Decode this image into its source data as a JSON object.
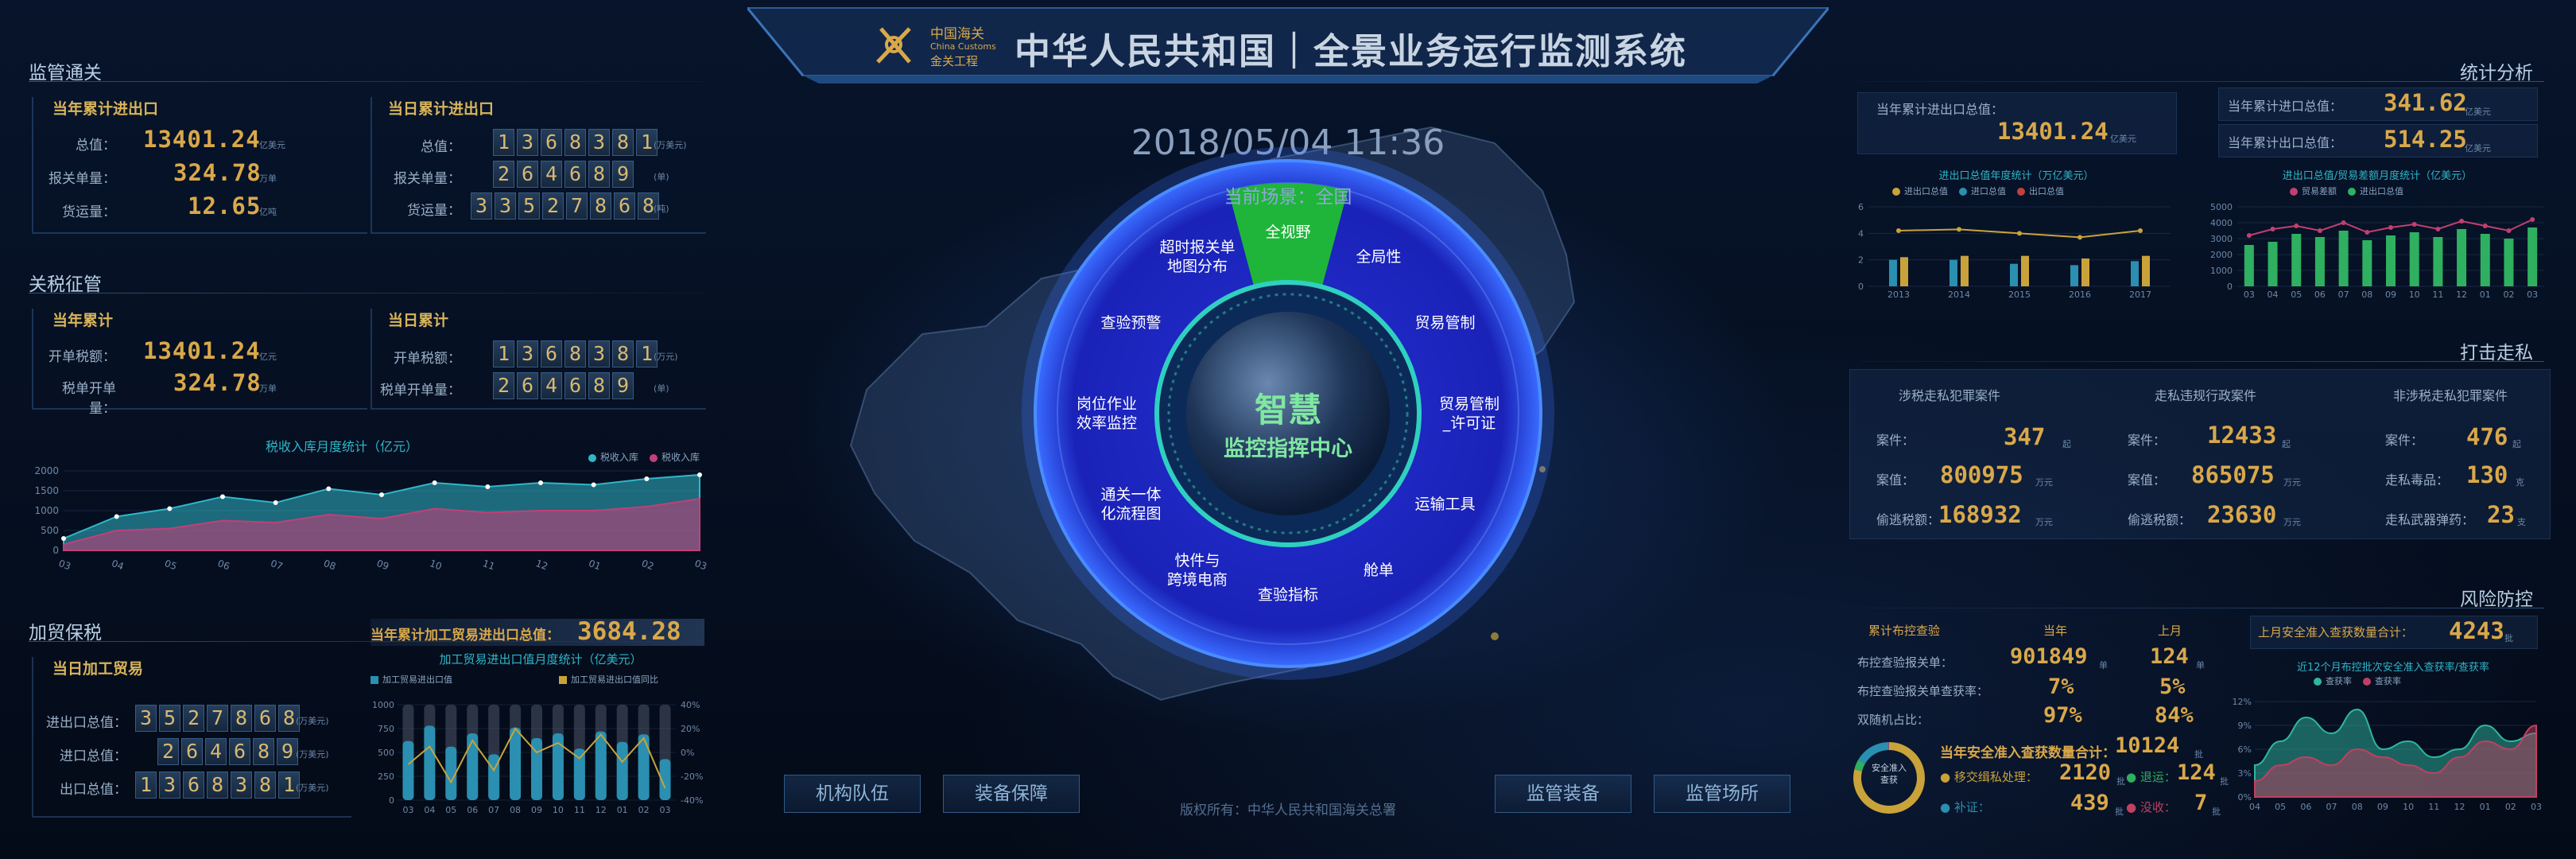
{
  "header": {
    "logo_cn": "中国海关",
    "logo_en": "China Customs",
    "logo_sub": "金关工程",
    "title": "中华人民共和国｜全景业务运行监测系统"
  },
  "datetime": "2018/05/04  11:36",
  "sections": {
    "supervision": "监管通关",
    "tariff": "关税征管",
    "processing": "加贸保税",
    "stats": "统计分析",
    "smuggling": "打击走私",
    "risk": "风险防控"
  },
  "supervision": {
    "left": {
      "title": "当年累计进出口",
      "rows": [
        {
          "label": "总值：",
          "value": "13401.24",
          "unit": "亿美元"
        },
        {
          "label": "报关单量：",
          "value": "324.78",
          "unit": "万单"
        },
        {
          "label": "货运量：",
          "value": "12.65",
          "unit": "亿吨"
        }
      ]
    },
    "right": {
      "title": "当日累计进出口",
      "rows": [
        {
          "label": "总值：",
          "digits": [
            "1",
            "3",
            "6",
            "8",
            "3",
            "8",
            "1"
          ],
          "unit": "(万美元)"
        },
        {
          "label": "报关单量：",
          "digits": [
            "2",
            "6",
            "4",
            "6",
            "8",
            "9"
          ],
          "unit": "(单)"
        },
        {
          "label": "货运量：",
          "digits": [
            "3",
            "3",
            "5",
            "2",
            "7",
            "8",
            "6",
            "8"
          ],
          "unit": "(吨)"
        }
      ]
    }
  },
  "tariff": {
    "left": {
      "title": "当年累计",
      "rows": [
        {
          "label": "开单税额：",
          "value": "13401.24",
          "unit": "亿元"
        },
        {
          "label": "税单开单量：",
          "value": "324.78",
          "unit": "万单"
        }
      ]
    },
    "right": {
      "title": "当日累计",
      "rows": [
        {
          "label": "开单税额：",
          "digits": [
            "1",
            "3",
            "6",
            "8",
            "3",
            "8",
            "1"
          ],
          "unit": "(万元)"
        },
        {
          "label": "税单开单量：",
          "digits": [
            "2",
            "6",
            "4",
            "6",
            "8",
            "9"
          ],
          "unit": "(单)"
        }
      ]
    }
  },
  "tax_chart": {
    "title": "税收入库月度统计（亿元）",
    "legend": [
      "税收入库",
      "税收入库"
    ],
    "colors": [
      "#2fb6c8",
      "#c0407a"
    ],
    "x": [
      "03",
      "04",
      "05",
      "06",
      "07",
      "08",
      "09",
      "10",
      "11",
      "12",
      "01",
      "02",
      "03"
    ],
    "y_ticks": [
      "2000",
      "1500",
      "1000",
      "500",
      "0"
    ],
    "ylim": [
      0,
      2000
    ],
    "series1": [
      300,
      850,
      1050,
      1350,
      1200,
      1550,
      1400,
      1700,
      1600,
      1700,
      1650,
      1800,
      1900
    ],
    "series2": [
      150,
      500,
      550,
      750,
      700,
      900,
      800,
      1050,
      950,
      1000,
      1000,
      1100,
      1300
    ]
  },
  "processing": {
    "total_label": "当年累计加工贸易进出口总值：",
    "total_value": "3684.28",
    "left_title": "当日加工贸易",
    "rows": [
      {
        "label": "进出口总值：",
        "digits": [
          "3",
          "5",
          "2",
          "7",
          "8",
          "6",
          "8"
        ],
        "unit": "(万美元)"
      },
      {
        "label": "进口总值：",
        "digits": [
          "2",
          "6",
          "4",
          "6",
          "8",
          "9"
        ],
        "unit": "(万美元)"
      },
      {
        "label": "出口总值：",
        "digits": [
          "1",
          "3",
          "6",
          "8",
          "3",
          "8",
          "1"
        ],
        "unit": "(万美元)"
      }
    ],
    "chart_title": "加工贸易进出口值月度统计（亿美元）",
    "legend": [
      "加工贸易进出口值",
      "加工贸易进出口值同比"
    ],
    "colors": [
      "#2a8fb0",
      "#c9a33a"
    ],
    "x": [
      "03",
      "04",
      "05",
      "06",
      "07",
      "08",
      "09",
      "10",
      "11",
      "12",
      "01",
      "02",
      "03"
    ],
    "y_left": [
      "1000",
      "750",
      "500",
      "250",
      "0"
    ],
    "y_right": [
      "40%",
      "20%",
      "0%",
      "-20%",
      "-40%"
    ],
    "values": [
      620,
      780,
      560,
      700,
      480,
      760,
      650,
      700,
      540,
      720,
      610,
      690,
      430
    ],
    "growth": [
      -10,
      5,
      -25,
      10,
      -15,
      20,
      0,
      8,
      -5,
      15,
      -8,
      12,
      -30
    ]
  },
  "center": {
    "wheel_top_label": "当前场景：全国",
    "core_title": "智慧",
    "core_sub": "监控指挥中心",
    "items": [
      {
        "label": "全视野"
      },
      {
        "label": "全局性"
      },
      {
        "label": "贸易管制"
      },
      {
        "label": "贸易管制\n_许可证"
      },
      {
        "label": "运输工具"
      },
      {
        "label": "舱单"
      },
      {
        "label": "查验指标"
      },
      {
        "label": "快件与\n跨境电商"
      },
      {
        "label": "通关一体\n化流程图"
      },
      {
        "label": "岗位作业\n效率监控"
      },
      {
        "label": "查验预警"
      },
      {
        "label": "超时报关单\n地图分布"
      }
    ],
    "buttons": [
      "机构队伍",
      "装备保障",
      "监管装备",
      "监管场所"
    ],
    "copyright": "版权所有：中华人民共和国海关总署"
  },
  "stats": {
    "left": {
      "rows": [
        {
          "label": "当年累计进出口总值：",
          "value": "13401.24",
          "unit": "亿美元"
        }
      ],
      "chart_title": "进出口总值年度统计（万亿美元）",
      "legend": [
        "进出口总值",
        "进口总值",
        "出口总值"
      ],
      "colors": [
        "#c9a33a",
        "#2a8fb0",
        "#c04040"
      ],
      "x": [
        "2013",
        "2014",
        "2015",
        "2016",
        "2017"
      ],
      "y_ticks": [
        "6",
        "4",
        "2",
        "0"
      ],
      "ylim": [
        0,
        6
      ],
      "import": [
        2.0,
        2.0,
        1.7,
        1.6,
        1.9
      ],
      "export": [
        2.2,
        2.3,
        2.3,
        2.1,
        2.3
      ],
      "total": [
        4.2,
        4.3,
        4.0,
        3.7,
        4.2
      ]
    },
    "right": {
      "rows": [
        {
          "label": "当年累计进口总值：",
          "value": "341.62",
          "unit": "亿美元"
        },
        {
          "label": "当年累计出口总值：",
          "value": "514.25",
          "unit": "亿美元"
        }
      ],
      "chart_title": "进出口总值/贸易差额月度统计（亿美元）",
      "legend": [
        "贸易差额",
        "进出口总值"
      ],
      "colors": [
        "#c04070",
        "#2fb060"
      ],
      "x": [
        "03",
        "04",
        "05",
        "06",
        "07",
        "08",
        "09",
        "10",
        "11",
        "12",
        "01",
        "02",
        "03"
      ],
      "y_ticks": [
        "5000",
        "4000",
        "3000",
        "2000",
        "1000",
        "0"
      ],
      "ylim": [
        0,
        5000
      ],
      "balance": [
        3200,
        3600,
        3800,
        3500,
        4000,
        3400,
        3700,
        3900,
        3600,
        4100,
        3800,
        3500,
        4200
      ],
      "total": [
        2600,
        2800,
        3300,
        3100,
        3500,
        2900,
        3200,
        3400,
        3100,
        3600,
        3300,
        3000,
        3700
      ]
    }
  },
  "smuggling": {
    "columns": [
      {
        "title": "涉税走私犯罪案件",
        "rows": [
          {
            "label": "案件：",
            "value": "347",
            "unit": "起"
          },
          {
            "label": "案值：",
            "value": "800975",
            "unit": "万元"
          },
          {
            "label": "偷逃税额：",
            "value": "168932",
            "unit": "万元"
          }
        ]
      },
      {
        "title": "走私违规行政案件",
        "rows": [
          {
            "label": "案件：",
            "value": "12433",
            "unit": "起"
          },
          {
            "label": "案值：",
            "value": "865075",
            "unit": "万元"
          },
          {
            "label": "偷逃税额：",
            "value": "23630",
            "unit": "万元"
          }
        ]
      },
      {
        "title": "非涉税走私犯罪案件",
        "rows": [
          {
            "label": "案件：",
            "value": "476",
            "unit": "起"
          },
          {
            "label": "走私毒品：",
            "value": "130",
            "unit": "克"
          },
          {
            "label": "走私武器弹药：",
            "value": "23",
            "unit": "支"
          }
        ]
      }
    ]
  },
  "risk": {
    "table_headers": [
      "累计布控查验",
      "当年",
      "上月"
    ],
    "rows": [
      {
        "label": "布控查验报关单：",
        "year": "901849",
        "year_unit": "单",
        "month": "124",
        "month_unit": "单"
      },
      {
        "label": "布控查验报关单查获率：",
        "year": "7%",
        "year_unit": "",
        "month": "5%",
        "month_unit": ""
      },
      {
        "label": "双随机占比：",
        "year": "97%",
        "year_unit": "",
        "month": "84%",
        "month_unit": ""
      }
    ],
    "right_label": "上月安全准入查获数量合计：",
    "right_value": "4243",
    "right_unit": "批",
    "chart_title": "近12个月布控批次安全准入查获率/查获率",
    "legend": [
      "查获率",
      "查获率"
    ],
    "colors": [
      "#2fb6a0",
      "#c04060"
    ],
    "x": [
      "04",
      "05",
      "06",
      "07",
      "08",
      "09",
      "10",
      "11",
      "12",
      "01",
      "02",
      "03"
    ],
    "y_ticks": [
      "12%",
      "9%",
      "6%",
      "3%",
      "0%"
    ],
    "ylim": [
      0,
      12
    ],
    "series1": [
      4,
      7,
      10,
      8,
      11,
      6,
      7,
      5,
      6,
      9,
      7,
      8
    ],
    "series2": [
      2,
      4,
      5,
      4,
      6,
      5,
      4,
      3,
      5,
      7,
      6,
      9
    ],
    "ring_label": "安全准入\n查获",
    "year_total_label": "当年安全准入查获数量合计：",
    "year_total_value": "10124",
    "year_total_unit": "批",
    "items": [
      {
        "label": "● 移交缉私处理：",
        "value": "2120",
        "unit": "批",
        "color": "#c9a33a"
      },
      {
        "label": "● 退运：",
        "value": "124",
        "unit": "批",
        "color": "#2fb060"
      },
      {
        "label": "● 补证：",
        "value": "439",
        "unit": "批",
        "color": "#2a8fb0"
      },
      {
        "label": "● 没收：",
        "value": "7",
        "unit": "批",
        "color": "#c04060"
      }
    ]
  }
}
